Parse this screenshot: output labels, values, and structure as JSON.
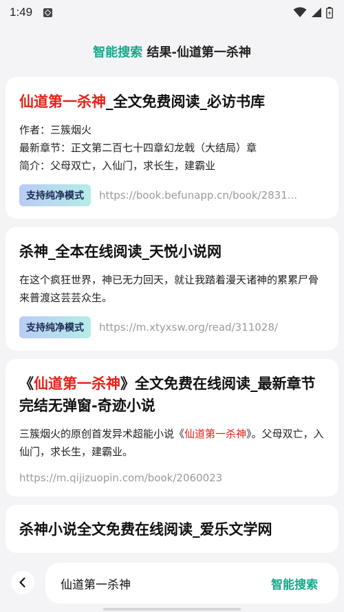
{
  "status_bar": {
    "time": "1:49"
  },
  "header": {
    "title_accent": "智能搜索",
    "title_rest": " 结果-仙道第一杀神"
  },
  "results": [
    {
      "title_pre": "",
      "title_highlight": "仙道第一杀神",
      "title_post": "_全文免费阅读_必访书库",
      "author": "作者：三簇烟火",
      "latest": "最新章节：正文第二百七十四章幻龙戟（大结局）章",
      "intro": "简介：父母双亡，入仙门，求长生，建霸业",
      "badge": "支持纯净模式",
      "url": "https://book.befunapp.cn/book/2831..."
    },
    {
      "title": "杀神_全本在线阅读_天悦小说网",
      "desc": "在这个疯狂世界，神已无力回天，就让我踏着漫天诸神的累累尸骨来普渡这芸芸众生。",
      "badge": "支持纯净模式",
      "url": "https://m.xtyxsw.org/read/311028/"
    },
    {
      "title_pre": "《",
      "title_highlight": "仙道第一杀神",
      "title_post": "》全文免费在线阅读_最新章节完结无弹窗-奇迹小说",
      "desc_pre": "三簇烟火的原创首发异术超能小说《",
      "desc_highlight": "仙道第一杀神",
      "desc_post": "》。父母双亡，入仙门，求长生，建霸业。",
      "url": "https://m.qijizuopin.com/book/2060023"
    },
    {
      "title": "杀神小说全文免费在线阅读_爱乐文学网"
    }
  ],
  "search": {
    "query": "仙道第一杀神",
    "button_label": "智能搜索"
  },
  "colors": {
    "accent": "#14a88a",
    "highlight": "#e62117"
  }
}
